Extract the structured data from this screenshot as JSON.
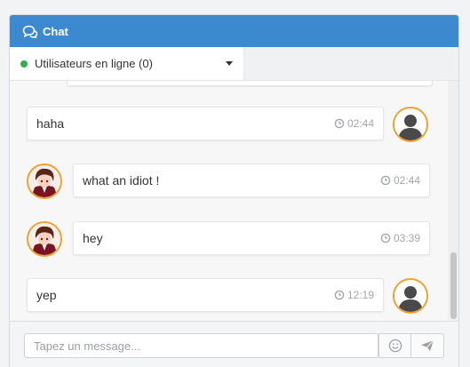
{
  "header": {
    "title": "Chat",
    "icon": "chat-bubbles-icon",
    "color": "#3d89cf"
  },
  "users": {
    "label": "Utilisateurs en ligne (0)",
    "status_color": "#2fb04b"
  },
  "messages": [
    {
      "side": "right",
      "text": "haha",
      "time": "02:44",
      "avatar": "default-user"
    },
    {
      "side": "left",
      "text": "what an idiot !",
      "time": "02:44",
      "avatar": "anime-character"
    },
    {
      "side": "left",
      "text": "hey",
      "time": "03:39",
      "avatar": "anime-character"
    },
    {
      "side": "right",
      "text": "yep",
      "time": "12:19",
      "avatar": "default-user"
    }
  ],
  "composer": {
    "placeholder": "Tapez un message...",
    "emoji_icon": "smiley-icon",
    "send_icon": "paper-plane-icon"
  }
}
